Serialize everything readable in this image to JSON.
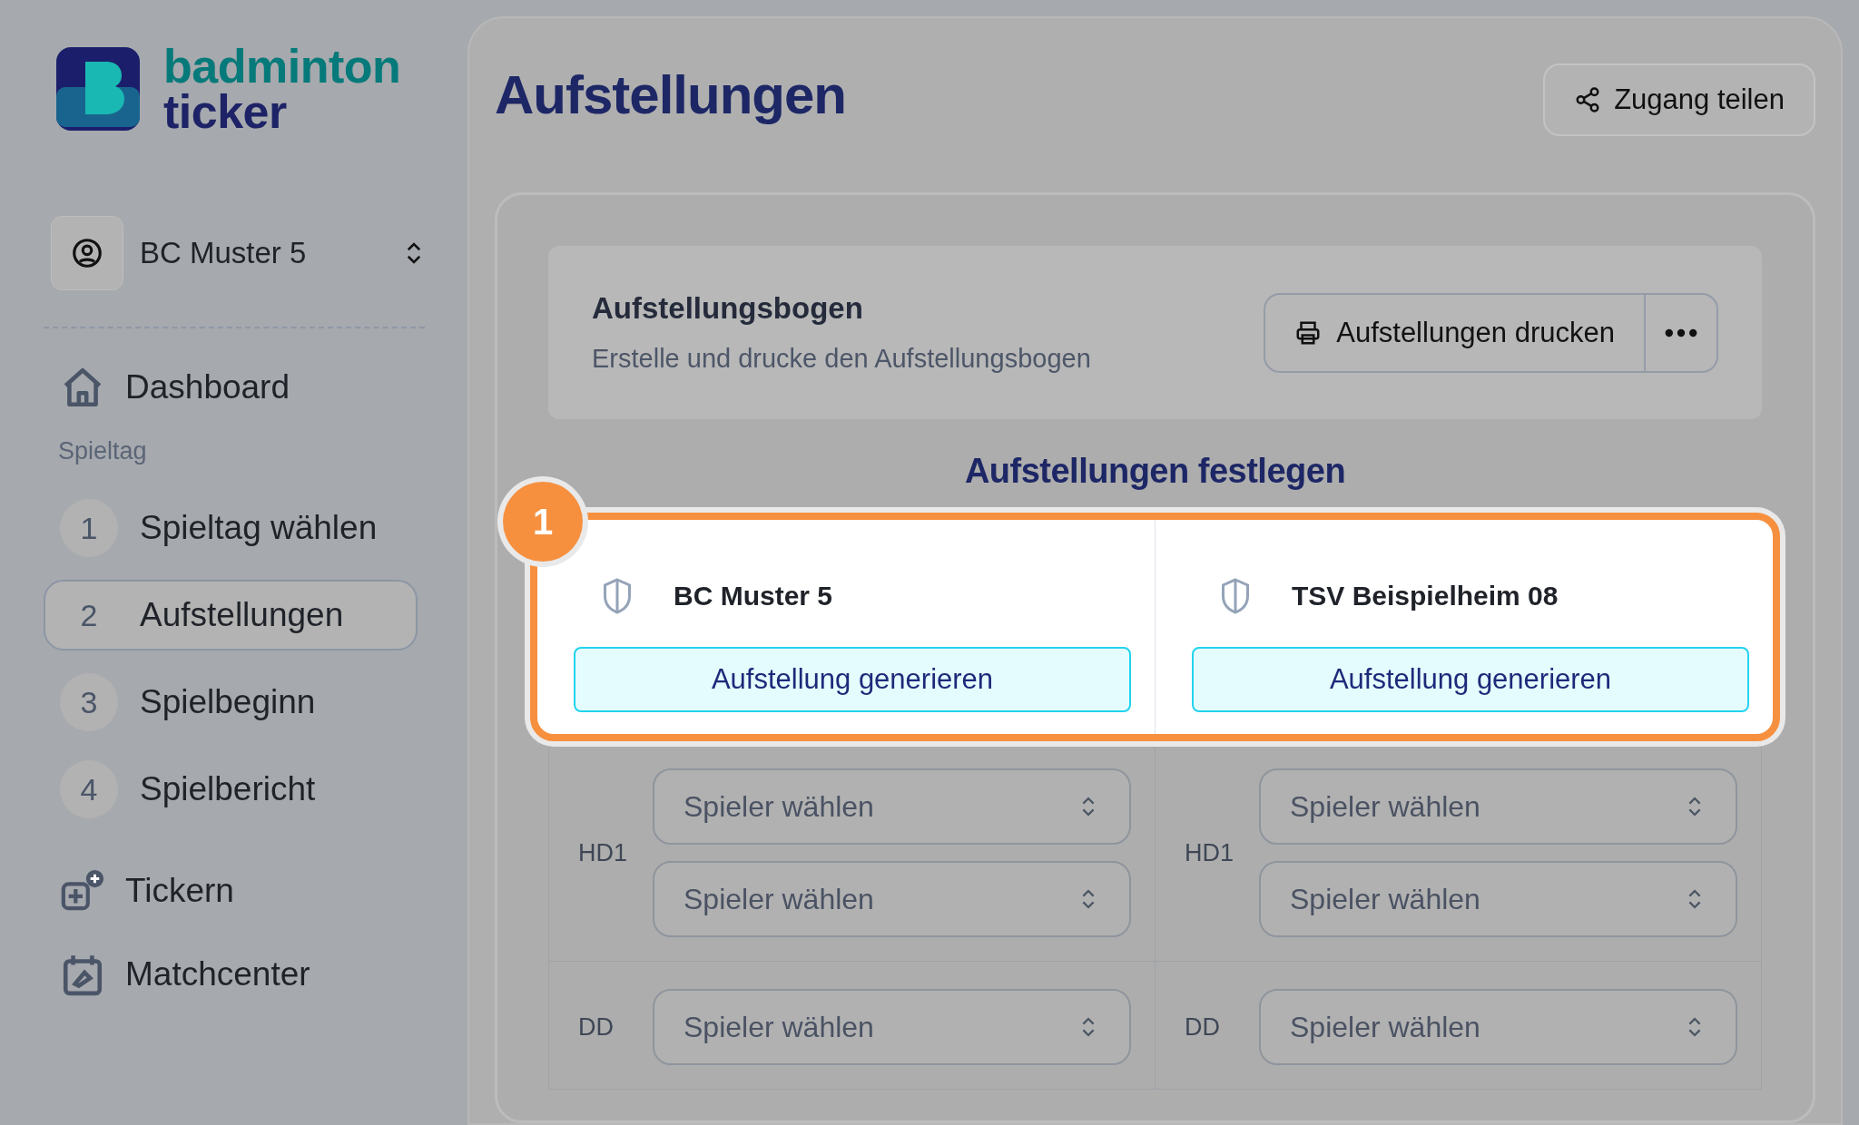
{
  "brand": {
    "line_1": "badminton",
    "line_2": "ticker"
  },
  "team_switcher": {
    "value": "BC Muster 5"
  },
  "sidebar": {
    "dashboard": "Dashboard",
    "section": "Spieltag",
    "steps": [
      {
        "number": "1",
        "label": "Spieltag wählen",
        "selected": false
      },
      {
        "number": "2",
        "label": "Aufstellungen",
        "selected": true
      },
      {
        "number": "3",
        "label": "Spielbeginn",
        "selected": false
      },
      {
        "number": "4",
        "label": "Spielbericht",
        "selected": false
      }
    ],
    "links": [
      {
        "label": "Tickern"
      },
      {
        "label": "Matchcenter"
      }
    ]
  },
  "page": {
    "title": "Aufstellungen",
    "share_button": "Zugang teilen"
  },
  "sheet": {
    "title": "Aufstellungsbogen",
    "description": "Erstelle und drucke den Aufstellungsbogen",
    "print_button": "Aufstellungen drucken"
  },
  "lineup": {
    "heading": "Aufstellungen festlegen",
    "badge": "1",
    "teams": [
      {
        "name": "BC Muster 5",
        "generate_button": "Aufstellung generieren"
      },
      {
        "name": "TSV Beispielheim 08",
        "generate_button": "Aufstellung generieren"
      }
    ],
    "rows": [
      {
        "columns": [
          {
            "label": "HD1",
            "slots": [
              {
                "placeholder": "Spieler wählen"
              },
              {
                "placeholder": "Spieler wählen"
              }
            ]
          },
          {
            "label": "HD1",
            "slots": [
              {
                "placeholder": "Spieler wählen"
              },
              {
                "placeholder": "Spieler wählen"
              }
            ]
          }
        ]
      },
      {
        "columns": [
          {
            "label": "DD",
            "slots": [
              {
                "placeholder": "Spieler wählen"
              }
            ]
          },
          {
            "label": "DD",
            "slots": [
              {
                "placeholder": "Spieler wählen"
              }
            ]
          }
        ]
      }
    ]
  }
}
